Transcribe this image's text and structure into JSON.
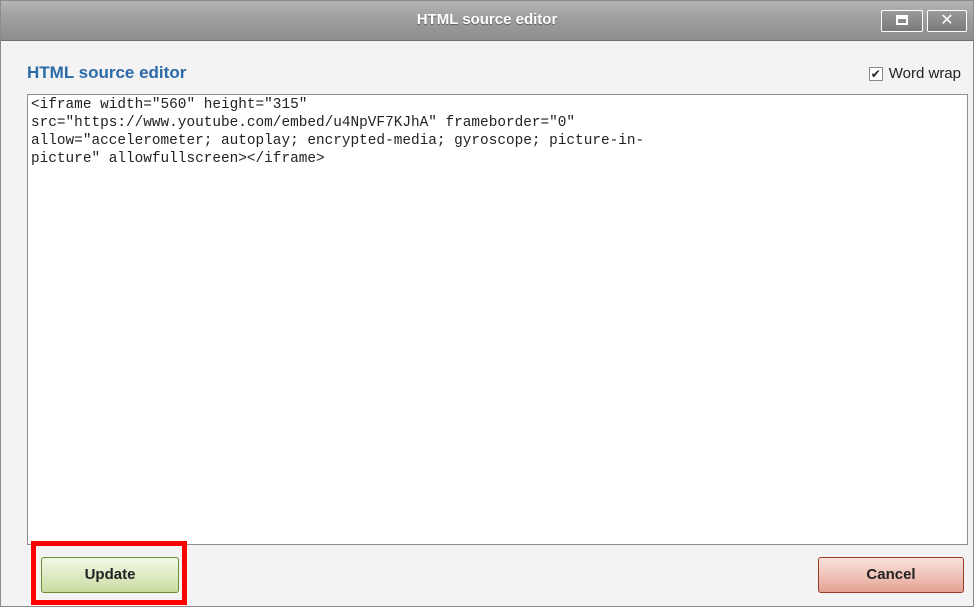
{
  "window": {
    "title": "HTML source editor"
  },
  "panel": {
    "heading": "HTML source editor",
    "word_wrap_label": "Word wrap",
    "word_wrap_checked": true
  },
  "editor": {
    "content": "<iframe width=\"560\" height=\"315\"\nsrc=\"https://www.youtube.com/embed/u4NpVF7KJhA\" frameborder=\"0\"\nallow=\"accelerometer; autoplay; encrypted-media; gyroscope; picture-in-\npicture\" allowfullscreen></iframe>"
  },
  "buttons": {
    "update_label": "Update",
    "cancel_label": "Cancel"
  },
  "icons": {
    "maximize": "maximize-icon",
    "close": "close-icon",
    "checkbox": "checkmark-icon"
  },
  "colors": {
    "heading": "#2b6aa8",
    "highlight": "#ff0000",
    "update_button": "#dce9c1",
    "cancel_button": "#efc1b6"
  }
}
